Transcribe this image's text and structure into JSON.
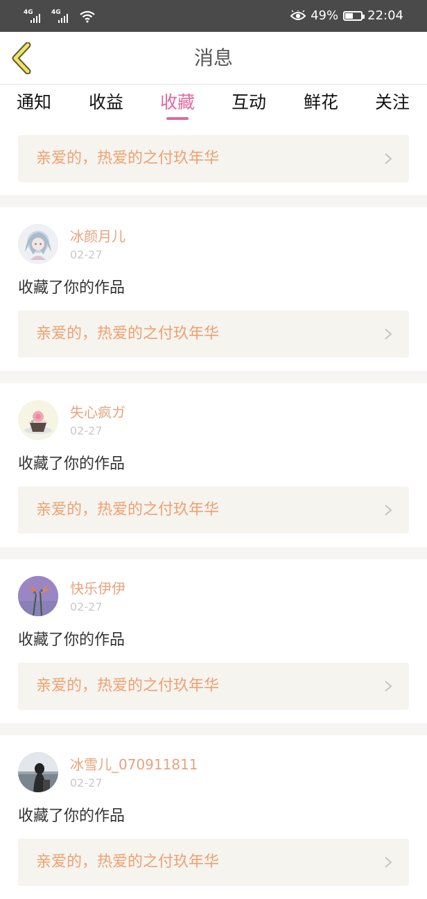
{
  "status_bar": {
    "network_1": "4G",
    "network_2": "4G",
    "battery_percent": "49%",
    "battery_level": 0.49,
    "time": "22:04"
  },
  "header": {
    "title": "消息"
  },
  "tabs": [
    {
      "label": "通知",
      "active": false
    },
    {
      "label": "收益",
      "active": false
    },
    {
      "label": "收藏",
      "active": true
    },
    {
      "label": "互动",
      "active": false
    },
    {
      "label": "鲜花",
      "active": false
    },
    {
      "label": "关注",
      "active": false
    }
  ],
  "top_work": {
    "title": "亲爱的，热爱的之付玖年华"
  },
  "items": [
    {
      "user": "冰颜月儿",
      "date": "02-27",
      "action": "收藏了你的作品",
      "work_title": "亲爱的，热爱的之付玖年华"
    },
    {
      "user": "失心疯ガ",
      "date": "02-27",
      "action": "收藏了你的作品",
      "work_title": "亲爱的，热爱的之付玖年华"
    },
    {
      "user": "快乐伊伊",
      "date": "02-27",
      "action": "收藏了你的作品",
      "work_title": "亲爱的，热爱的之付玖年华"
    },
    {
      "user": "冰雪儿_070911811",
      "date": "02-27",
      "action": "收藏了你的作品",
      "work_title": "亲爱的，热爱的之付玖年华"
    }
  ],
  "colors": {
    "accent": "#e0679e",
    "username": "#e8a37c",
    "work_title": "#f0a070",
    "work_bg": "#f5f4ef",
    "status_bar_bg": "#4a4a4a",
    "back_icon": "#f0e26a"
  }
}
